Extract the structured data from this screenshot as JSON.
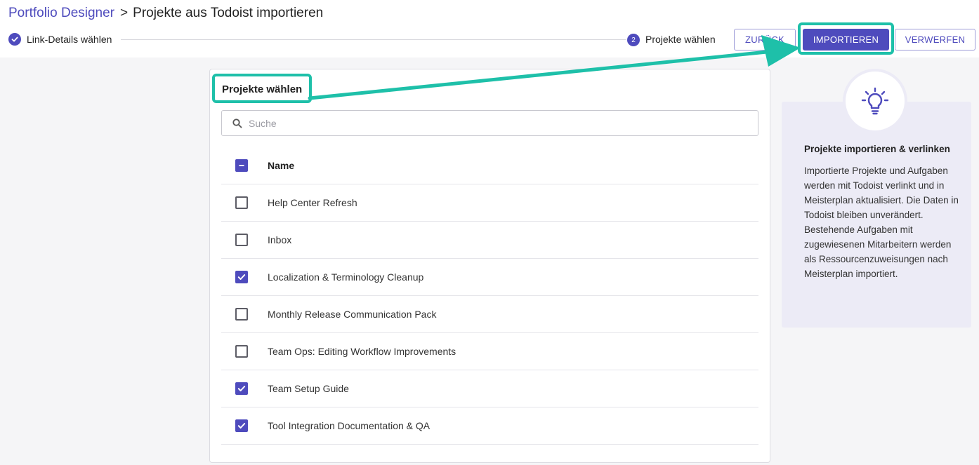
{
  "breadcrumb": {
    "parent": "Portfolio Designer",
    "separator": ">",
    "current": "Projekte aus Todoist importieren"
  },
  "stepper": {
    "step1_label": "Link-Details wählen",
    "step2_number": "2",
    "step2_label": "Projekte wählen"
  },
  "actions": {
    "back_label": "ZURÜCK",
    "import_label": "IMPORTIEREN",
    "discard_label": "VERWERFEN"
  },
  "card": {
    "title": "Projekte wählen",
    "search_placeholder": "Suche",
    "search_value": "",
    "column_name": "Name",
    "projects": [
      {
        "name": "Help Center Refresh",
        "checked": false
      },
      {
        "name": "Inbox",
        "checked": false
      },
      {
        "name": "Localization & Terminology Cleanup",
        "checked": true
      },
      {
        "name": "Monthly Release Communication Pack",
        "checked": false
      },
      {
        "name": "Team Ops: Editing Workflow Improvements",
        "checked": false
      },
      {
        "name": "Team Setup Guide",
        "checked": true
      },
      {
        "name": "Tool Integration Documentation & QA",
        "checked": true
      }
    ]
  },
  "info": {
    "icon": "lightbulb-icon",
    "title": "Projekte importieren & verlinken",
    "text": "Importierte Projekte und Aufgaben werden mit Todoist verlinkt und in Meisterplan aktualisiert. Die Daten in Todoist bleiben unverändert. Bestehende Aufgaben mit zugewiesenen Mitarbeitern werden als Ressourcenzuweisungen nach Meisterplan importiert."
  },
  "colors": {
    "accent": "#4e4bbd",
    "highlight": "#1ec0a9",
    "panel": "#ecebf6"
  }
}
